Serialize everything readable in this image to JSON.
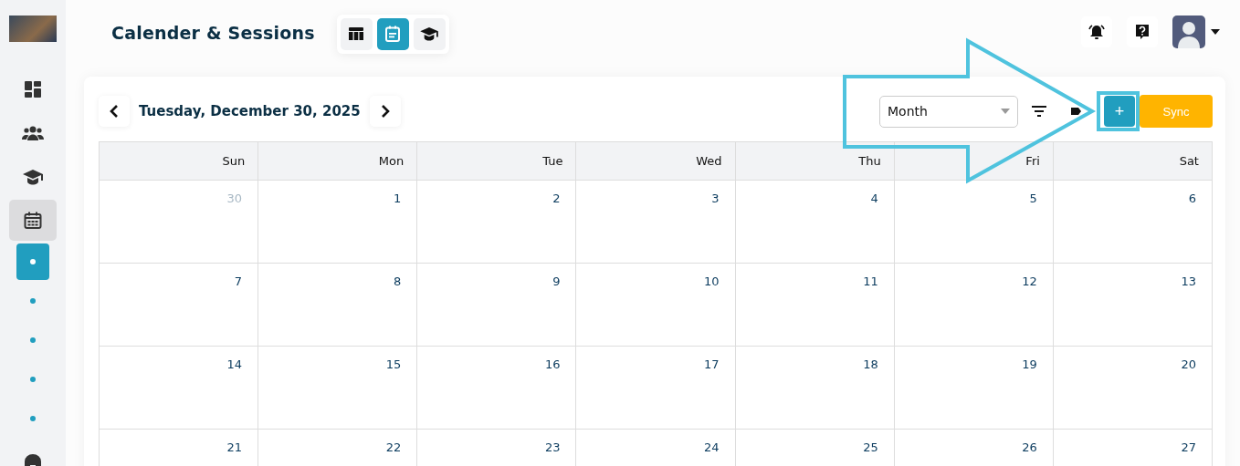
{
  "page_title": "Calender & Sessions",
  "view_toggles": [
    {
      "kind": "table",
      "selected": false
    },
    {
      "kind": "calendar",
      "selected": true
    },
    {
      "kind": "graduation",
      "selected": false
    }
  ],
  "sidebar": {
    "items": [
      {
        "kind": "dashboard",
        "selected": false
      },
      {
        "kind": "people",
        "selected": false
      },
      {
        "kind": "graduation",
        "selected": false
      },
      {
        "kind": "calendar",
        "selected": true
      },
      {
        "kind": "dot",
        "selected": true
      },
      {
        "kind": "dot",
        "selected": false
      },
      {
        "kind": "dot",
        "selected": false
      },
      {
        "kind": "dot",
        "selected": false
      },
      {
        "kind": "dot",
        "selected": false
      },
      {
        "kind": "store",
        "selected": false
      }
    ]
  },
  "toolbar": {
    "date": "Tuesday, December 30, 2025",
    "view_select": "Month",
    "add_button": "+",
    "sync_button": "Sync"
  },
  "calendar": {
    "columns": [
      "Sun",
      "Mon",
      "Tue",
      "Wed",
      "Thu",
      "Fri",
      "Sat"
    ],
    "weeks": [
      [
        {
          "day": "30",
          "muted": true
        },
        {
          "day": "1",
          "muted": false
        },
        {
          "day": "2",
          "muted": false
        },
        {
          "day": "3",
          "muted": false
        },
        {
          "day": "4",
          "muted": false
        },
        {
          "day": "5",
          "muted": false
        },
        {
          "day": "6",
          "muted": false
        }
      ],
      [
        {
          "day": "7",
          "muted": false
        },
        {
          "day": "8",
          "muted": false
        },
        {
          "day": "9",
          "muted": false
        },
        {
          "day": "10",
          "muted": false
        },
        {
          "day": "11",
          "muted": false
        },
        {
          "day": "12",
          "muted": false
        },
        {
          "day": "13",
          "muted": false
        }
      ],
      [
        {
          "day": "14",
          "muted": false
        },
        {
          "day": "15",
          "muted": false
        },
        {
          "day": "16",
          "muted": false
        },
        {
          "day": "17",
          "muted": false
        },
        {
          "day": "18",
          "muted": false
        },
        {
          "day": "19",
          "muted": false
        },
        {
          "day": "20",
          "muted": false
        }
      ],
      [
        {
          "day": "21",
          "muted": false
        },
        {
          "day": "22",
          "muted": false
        },
        {
          "day": "23",
          "muted": false
        },
        {
          "day": "24",
          "muted": false
        },
        {
          "day": "25",
          "muted": false
        },
        {
          "day": "26",
          "muted": false
        },
        {
          "day": "27",
          "muted": false
        }
      ]
    ]
  }
}
